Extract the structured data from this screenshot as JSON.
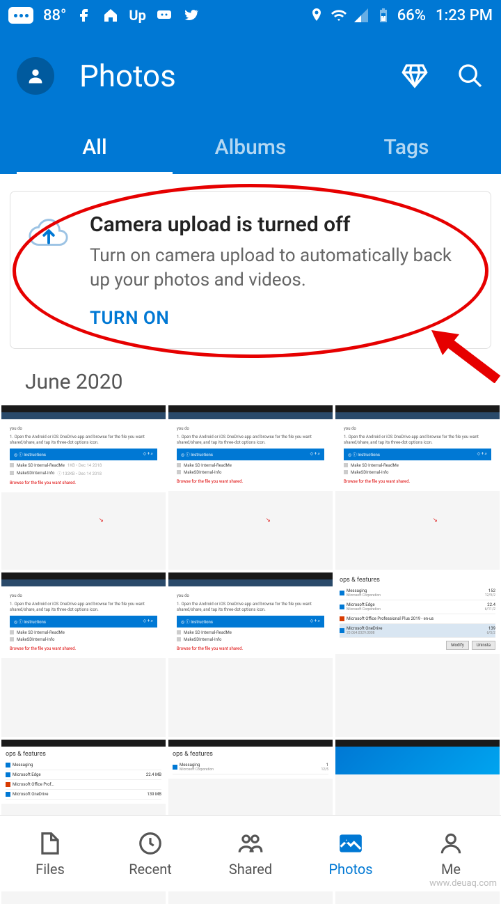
{
  "status": {
    "temperature": "88°",
    "battery": "66%",
    "time": "1:23 PM"
  },
  "header": {
    "title": "Photos"
  },
  "tabs": {
    "all": "All",
    "albums": "Albums",
    "tags": "Tags"
  },
  "banner": {
    "title": "Camera upload is turned off",
    "body": "Turn on camera upload to automatically back up your photos and videos.",
    "button": "TURN ON"
  },
  "section": {
    "label": "June 2020"
  },
  "bottom_nav": {
    "files": "Files",
    "recent": "Recent",
    "shared": "Shared",
    "photos": "Photos",
    "me": "Me"
  },
  "watermark": "www.deuaq.com"
}
